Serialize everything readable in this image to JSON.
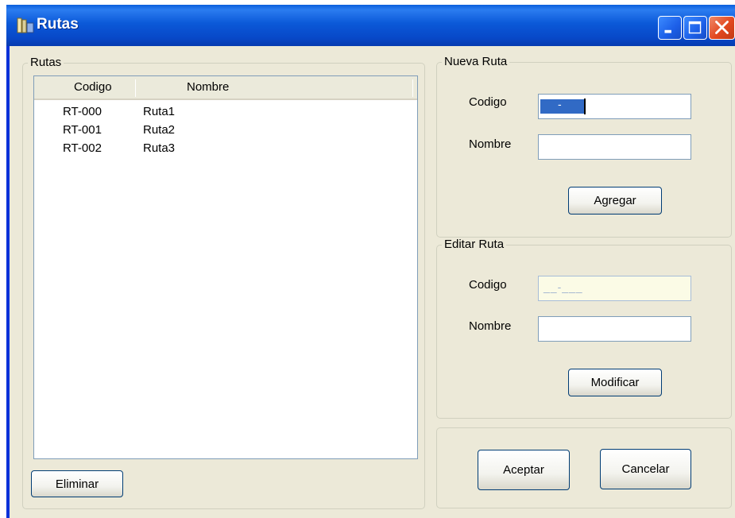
{
  "window": {
    "title": "Rutas"
  },
  "rutas_group": {
    "legend": "Rutas",
    "columns": [
      "Codigo",
      "Nombre"
    ],
    "rows": [
      {
        "codigo": "RT-000",
        "nombre": "Ruta1"
      },
      {
        "codigo": "RT-001",
        "nombre": "Ruta2"
      },
      {
        "codigo": "RT-002",
        "nombre": "Ruta3"
      }
    ],
    "delete_label": "Eliminar"
  },
  "nueva_ruta": {
    "legend": "Nueva Ruta",
    "codigo_label": "Codigo",
    "codigo_mask": "  -   ",
    "nombre_label": "Nombre",
    "nombre_value": "",
    "add_label": "Agregar"
  },
  "editar_ruta": {
    "legend": "Editar Ruta",
    "codigo_label": "Codigo",
    "codigo_mask": "__-___",
    "nombre_label": "Nombre",
    "nombre_value": "",
    "modify_label": "Modificar"
  },
  "actions": {
    "accept_label": "Aceptar",
    "cancel_label": "Cancelar"
  },
  "colors": {
    "titlebar": "#0b59d8",
    "window_bg": "#ece9d8",
    "selection": "#316ac5"
  }
}
